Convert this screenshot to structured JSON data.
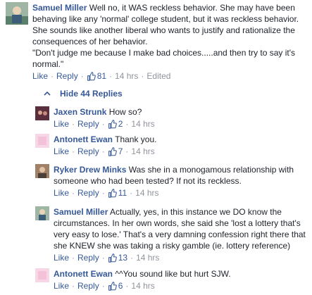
{
  "main_comment": {
    "author": "Samuel Miller",
    "text": "Well no, it WAS reckless behavior. She may have been behaving like any 'normal' college student, but it was reckless behavior. She sounds like another liberal who wants to justify and rationalize the consequences of her behavior.",
    "quote": "\"Don't judge me because I make bad choices.....and then try to say it's normal.\"",
    "like_label": "Like",
    "reply_label": "Reply",
    "likes": "81",
    "time": "14 hrs",
    "edited": "Edited"
  },
  "replies_toggle": "Hide 44 Replies",
  "replies": [
    {
      "author": "Jaxen Strunk",
      "text": "How so?",
      "like_label": "Like",
      "reply_label": "Reply",
      "likes": "2",
      "time": "14 hrs"
    },
    {
      "author": "Antonett Ewan",
      "text": "Thank you.",
      "like_label": "Like",
      "reply_label": "Reply",
      "likes": "7",
      "time": "14 hrs"
    },
    {
      "author": "Ryker Drew Minks",
      "text": "Was she in a monogamous relationship with someone who had been tested? If not its reckless.",
      "like_label": "Like",
      "reply_label": "Reply",
      "likes": "11",
      "time": "14 hrs"
    },
    {
      "author": "Samuel Miller",
      "text": "Actually, yes, in this instance we DO know the circumstances. In her own words, she said she 'lost a lottery that's very easy to lose.' That's a very damning confession right there that she KNEW she was taking a risky gamble (ie. lottery reference)",
      "like_label": "Like",
      "reply_label": "Reply",
      "likes": "13",
      "time": "14 hrs"
    },
    {
      "author": "Antonett Ewan",
      "text": "^^You sound like but hurt SJW.",
      "like_label": "Like",
      "reply_label": "Reply",
      "likes": "6",
      "time": "14 hrs"
    }
  ],
  "dot": "·"
}
